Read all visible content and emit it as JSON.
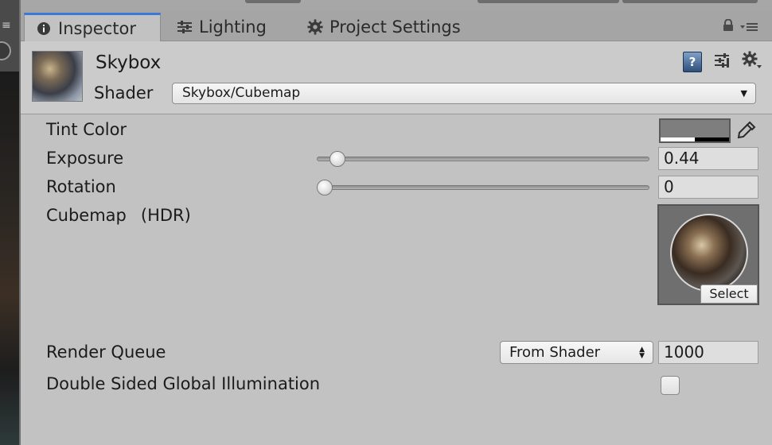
{
  "tabs": [
    {
      "label": "Inspector",
      "icon": "info-icon"
    },
    {
      "label": "Lighting",
      "icon": "lighting-sliders-icon"
    },
    {
      "label": "Project Settings",
      "icon": "gear-icon"
    }
  ],
  "header": {
    "asset_name": "Skybox",
    "shader_label": "Shader",
    "shader_value": "Skybox/Cubemap"
  },
  "properties": {
    "tint_color_label": "Tint Color",
    "tint_color_value": "#7e7e7e",
    "exposure_label": "Exposure",
    "exposure_value": "0.44",
    "exposure_slider_fraction": 0.04,
    "rotation_label": "Rotation",
    "rotation_value": "0",
    "rotation_slider_fraction": 0.0,
    "cubemap_label": "Cubemap",
    "cubemap_hdr": "(HDR)",
    "cubemap_select": "Select",
    "render_queue_label": "Render Queue",
    "render_queue_mode": "From Shader",
    "render_queue_value": "1000",
    "double_sided_gi_label": "Double Sided Global Illumination",
    "double_sided_gi_checked": false
  },
  "colors": {
    "panel_bg": "#c2c2c2",
    "active_tab_accent": "#3c78d8"
  }
}
